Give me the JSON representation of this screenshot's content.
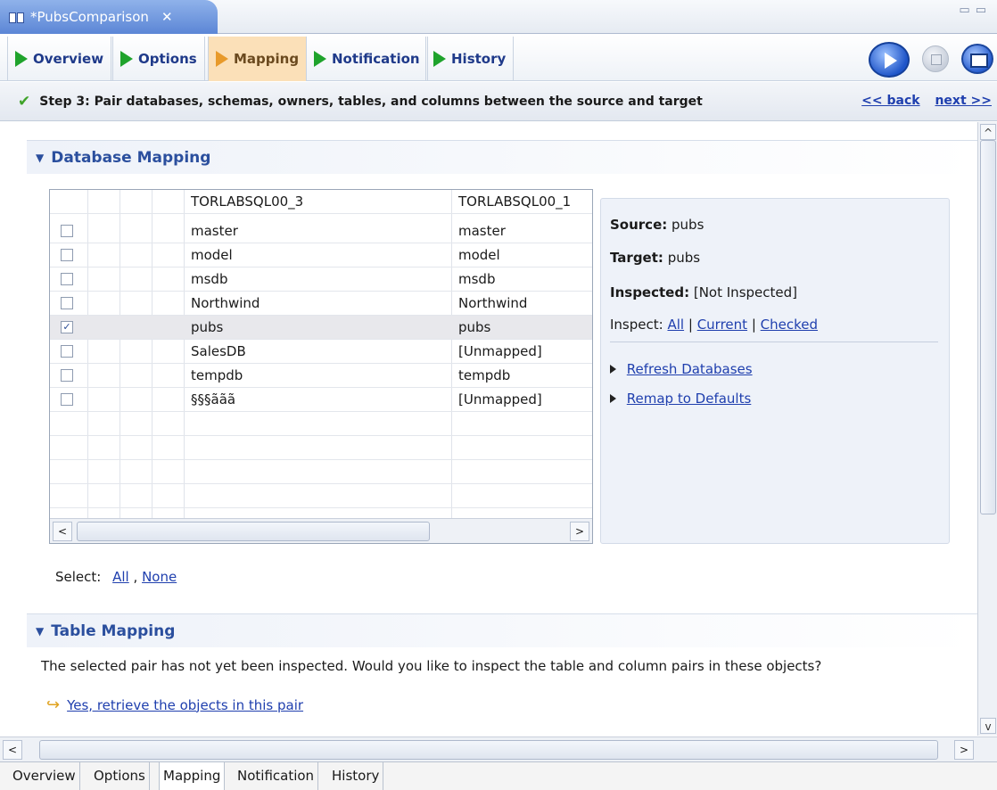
{
  "editor_tab": {
    "title": "*PubsComparison",
    "close": "✕"
  },
  "steps": [
    {
      "label": "Overview",
      "active": false
    },
    {
      "label": "Options",
      "active": false
    },
    {
      "label": "Mapping",
      "active": true
    },
    {
      "label": "Notification",
      "active": false
    },
    {
      "label": "History",
      "active": false
    }
  ],
  "step_desc": {
    "text": "Step 3: Pair databases, schemas, owners, tables, and columns between the source and target",
    "back": "<< back",
    "next": "next >>"
  },
  "database_mapping": {
    "title": "Database Mapping",
    "columns": [
      "TORLABSQL00_3",
      "TORLABSQL00_1"
    ],
    "rows": [
      {
        "checked": false,
        "source": "master",
        "target": "master"
      },
      {
        "checked": false,
        "source": "model",
        "target": "model"
      },
      {
        "checked": false,
        "source": "msdb",
        "target": "msdb"
      },
      {
        "checked": false,
        "source": "Northwind",
        "target": "Northwind"
      },
      {
        "checked": true,
        "source": "pubs",
        "target": "pubs"
      },
      {
        "checked": false,
        "source": "SalesDB",
        "target": "[Unmapped]"
      },
      {
        "checked": false,
        "source": "tempdb",
        "target": "tempdb"
      },
      {
        "checked": false,
        "source": "§§§ããã",
        "target": "[Unmapped]"
      }
    ],
    "select_label": "Select:",
    "select_all": "All",
    "select_none": "None"
  },
  "details": {
    "source_label": "Source:",
    "source_value": "pubs",
    "target_label": "Target:",
    "target_value": "pubs",
    "inspected_label": "Inspected:",
    "inspected_value": "[Not Inspected]",
    "inspect_label": "Inspect:",
    "inspect_all": "All",
    "inspect_current": "Current",
    "inspect_checked": "Checked",
    "sep": "|",
    "refresh": "Refresh Databases",
    "remap": "Remap to Defaults"
  },
  "table_mapping": {
    "title": "Table Mapping",
    "message": "The selected pair has not yet been inspected. Would you like to inspect the table and column pairs in these objects?",
    "retrieve_link": "Yes, retrieve the objects in this pair"
  },
  "page_tabs": [
    "Overview",
    "Options",
    "Mapping",
    "Notification",
    "History"
  ],
  "colors": {
    "accent": "#2b4f9e",
    "link": "#1f3fae",
    "active_step": "#fbe0b8",
    "step_arrow": "#1fa32c"
  }
}
